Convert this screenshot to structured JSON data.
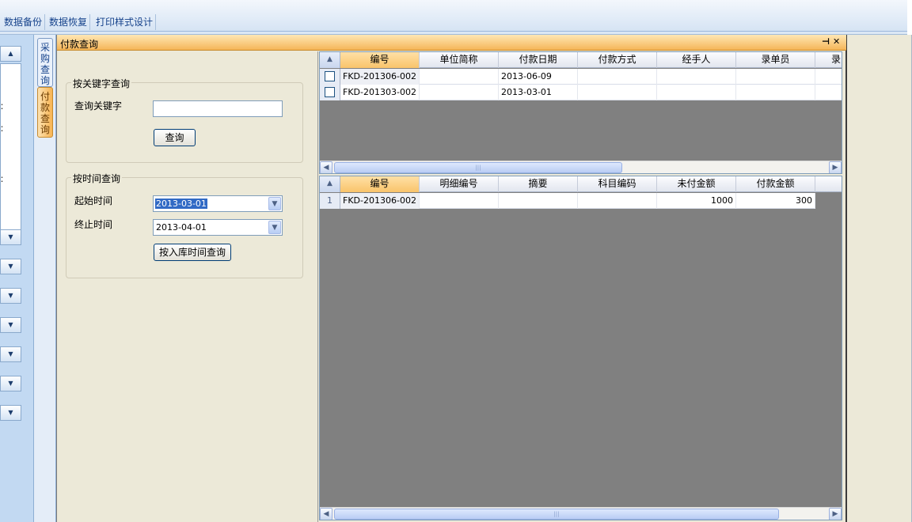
{
  "toolbar": {
    "buttons": [
      "数据备份",
      "数据恢复",
      "打印样式设计"
    ]
  },
  "leftnav": {
    "marks": [
      "：",
      "：",
      "："
    ]
  },
  "vtabs": [
    {
      "label": "采购查询",
      "active": false
    },
    {
      "label": "付款查询",
      "active": true
    }
  ],
  "window": {
    "title": "付款查询",
    "pin_icon": "pin-icon",
    "close_icon": "close-icon"
  },
  "keyword_group": {
    "title": "按关键字查询",
    "label": "查询关键字",
    "value": "",
    "button": "查询"
  },
  "time_group": {
    "title": "按时间查询",
    "start_label": "起始时间",
    "start_value": "2013-03-01",
    "end_label": "终止时间",
    "end_value": "2013-04-01",
    "button": "按入库时间查询"
  },
  "main_grid": {
    "columns": [
      "编号",
      "单位简称",
      "付款日期",
      "付款方式",
      "经手人",
      "录单员",
      "录"
    ],
    "rows": [
      [
        "FKD-201306-002",
        "",
        "2013-06-09",
        "",
        "",
        "",
        ""
      ],
      [
        "FKD-201303-002",
        "",
        "2013-03-01",
        "",
        "",
        "",
        ""
      ]
    ]
  },
  "detail_grid": {
    "columns": [
      "编号",
      "明细编号",
      "摘要",
      "科目编码",
      "未付金额",
      "付款金额"
    ],
    "rows": [
      {
        "rownum": "1",
        "cells": [
          "FKD-201306-002",
          "",
          "",
          "",
          "1000",
          "300"
        ]
      }
    ]
  }
}
